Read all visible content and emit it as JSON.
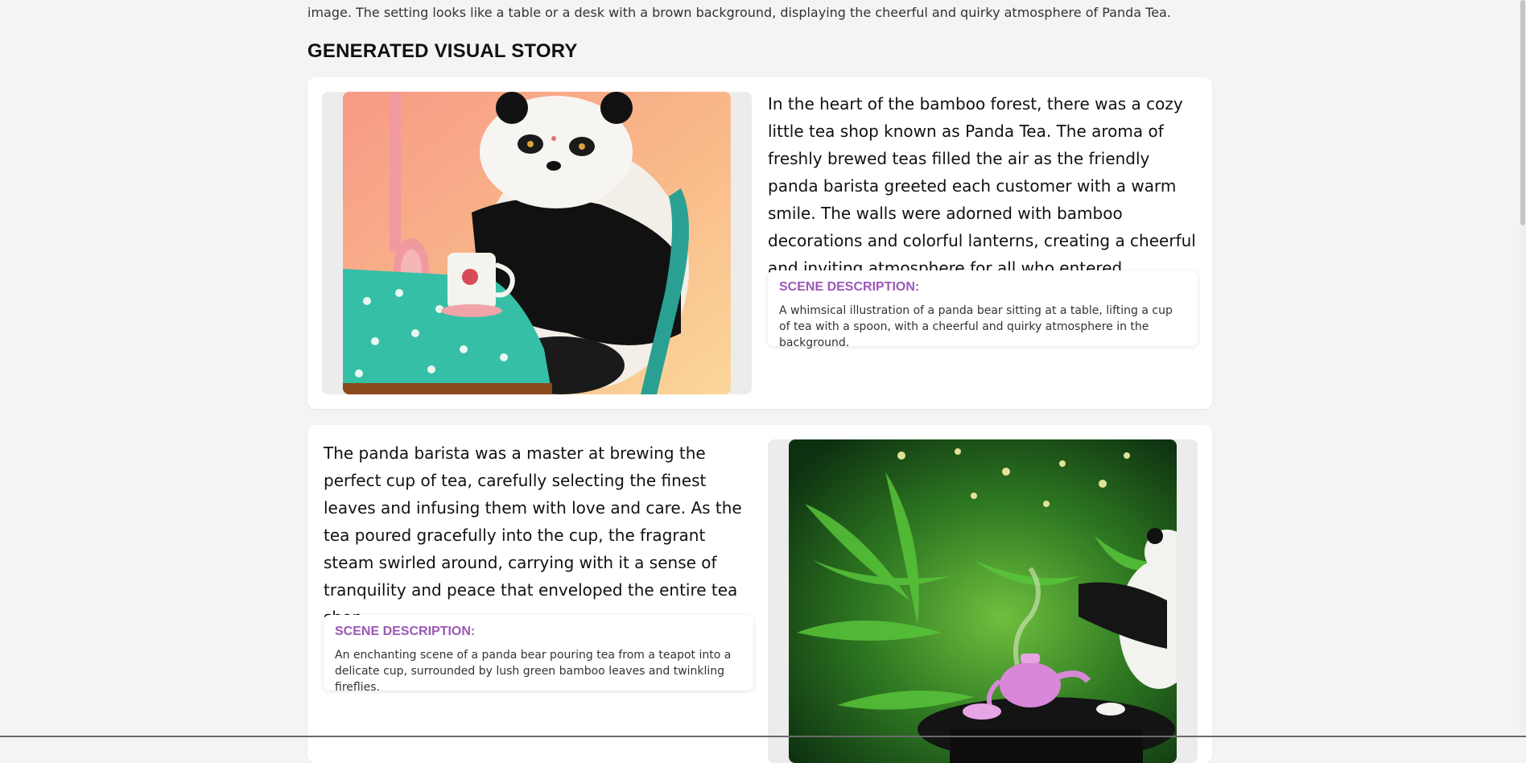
{
  "intro_fragment": "image. The setting looks like a table or a desk with a brown background, displaying the cheerful and quirky atmosphere of Panda Tea.",
  "section_title": "GENERATED VISUAL STORY",
  "scenes": [
    {
      "story": "In the heart of the bamboo forest, there was a cozy little tea shop known as Panda Tea. The aroma of freshly brewed teas filled the air as the friendly panda barista greeted each customer with a warm smile. The walls were adorned with bamboo decorations and colorful lanterns, creating a cheerful and inviting atmosphere for all who entered.",
      "scene_label": "SCENE DESCRIPTION:",
      "scene_text": "A whimsical illustration of a panda bear sitting at a table, lifting a cup of tea with a spoon, with a cheerful and quirky atmosphere in the background."
    },
    {
      "story": "The panda barista was a master at brewing the perfect cup of tea, carefully selecting the finest leaves and infusing them with love and care. As the tea poured gracefully into the cup, the fragrant steam swirled around, carrying with it a sense of tranquility and peace that enveloped the entire tea shop.",
      "scene_label": "SCENE DESCRIPTION:",
      "scene_text": "An enchanting scene of a panda bear pouring tea from a teapot into a delicate cup, surrounded by lush green bamboo leaves and twinkling fireflies."
    }
  ],
  "colors": {
    "accent": "#9b59b6",
    "background": "#f4f4f4",
    "card": "#ffffff"
  }
}
